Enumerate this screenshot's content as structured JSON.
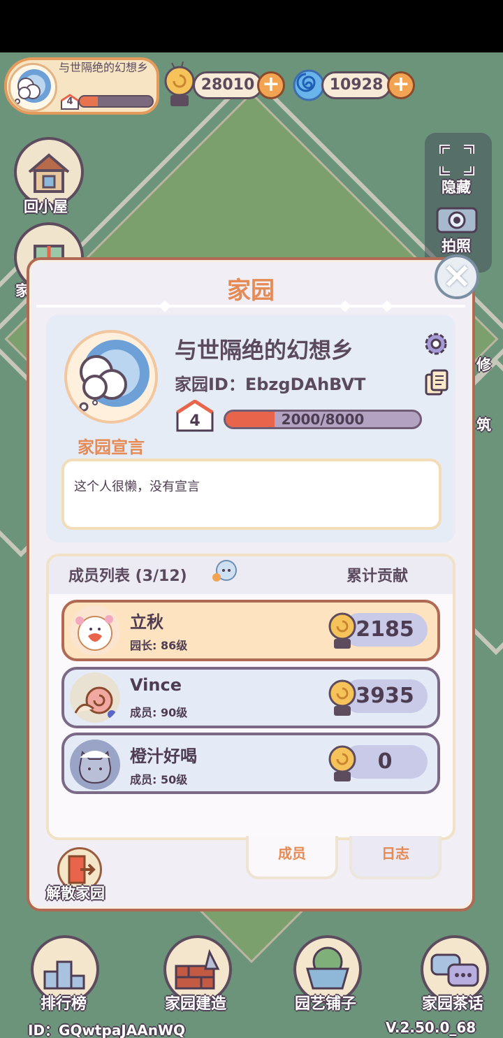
{
  "home": {
    "name": "与世隔绝的幻想乡",
    "level": "4",
    "progress_fraction": 0.25
  },
  "currency": {
    "snail_coins": "28010",
    "spiral_gems": "10928"
  },
  "left_buttons": {
    "back_home": "回小屋",
    "home_partial": "家"
  },
  "right_panel": {
    "hide": "隐藏",
    "photo": "拍照",
    "repair_partial": "修",
    "build_partial": "筑"
  },
  "dialog": {
    "title": "家园",
    "garden_name": "与世隔绝的幻想乡",
    "garden_id": "家园ID：EbzgDAhBVT",
    "level": "4",
    "xp": "2000/8000",
    "xp_fraction": 0.25,
    "declaration_label": "家园宣言",
    "declaration_text": "这个人很懒，没有宣言",
    "members_title": "成员列表 (3/12)",
    "contribution_title": "累计贡献",
    "members": [
      {
        "name": "立秋",
        "role": "园长: 86级",
        "contribution": "2185"
      },
      {
        "name": "Vince",
        "role": "成员: 90级",
        "contribution": "3935"
      },
      {
        "name": "橙汁好喝",
        "role": "成员: 50级",
        "contribution": "0"
      }
    ],
    "tabs": {
      "members": "成员",
      "log": "日志"
    },
    "dissolve": "解散家园"
  },
  "bottom_nav": {
    "ranking": "排行榜",
    "build": "家园建造",
    "shop": "园艺铺子",
    "chat": "家园茶话"
  },
  "footer": {
    "user_id": "ID：GQwtpaJAAnWQ",
    "version": "V.2.50.0_68"
  },
  "colors": {
    "accent_orange": "#e58a54",
    "dark_outline": "#5d4c5e",
    "progress_red": "#e8644a"
  }
}
